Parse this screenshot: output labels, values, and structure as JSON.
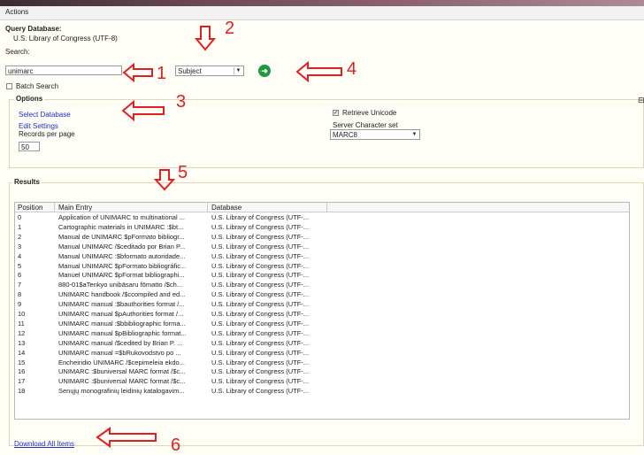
{
  "menu": {
    "actions": "Actions"
  },
  "query": {
    "label": "Query Database:",
    "database": "U.S. Library of Congress (UTF-8)",
    "search_label": "Search:",
    "search_value": "unimarc",
    "field_selected": "Subject",
    "batch_label": "Batch Search"
  },
  "options": {
    "legend": "Options",
    "select_database": "Select Database",
    "edit_settings": "Edit Settings",
    "records_label": "Records per page",
    "records_value": "50",
    "retrieve_unicode": "Retrieve Unicode",
    "charset_label": "Server Character set",
    "charset_value": "MARC8"
  },
  "results": {
    "legend": "Results",
    "columns": [
      "Position",
      "Main Entry",
      "Database"
    ],
    "rows": [
      [
        "0",
        "Application of UNIMARC to multinational ...",
        "U.S. Library of Congress (UTF-..."
      ],
      [
        "1",
        "Cartographic materials in UNIMARC :$bt...",
        "U.S. Library of Congress (UTF-..."
      ],
      [
        "2",
        "Manual de UNIMARC $pFormato bibliogr...",
        "U.S. Library of Congress (UTF-..."
      ],
      [
        "3",
        "Manual UNIMARC /$ceditado por Brian P...",
        "U.S. Library of Congress (UTF-..."
      ],
      [
        "4",
        "Manual UNIMARC :$bformato autoridade...",
        "U.S. Library of Congress (UTF-..."
      ],
      [
        "5",
        "Manual UNIMARC $pFormato bibliográfic...",
        "U.S. Library of Congress (UTF-..."
      ],
      [
        "6",
        "Manuel UNIMARC $pFormat bibliographi...",
        "U.S. Library of Congress (UTF-..."
      ],
      [
        "7",
        "880-01$aTenkyo unibāsaru fōmatto /$ch...",
        "U.S. Library of Congress (UTF-..."
      ],
      [
        "8",
        "UNIMARC handbook /$ccompiled and ed...",
        "U.S. Library of Congress (UTF-..."
      ],
      [
        "9",
        "UNIMARC manual :$bauthorities format /...",
        "U.S. Library of Congress (UTF-..."
      ],
      [
        "10",
        "UNIMARC manual $pAuthorities format /...",
        "U.S. Library of Congress (UTF-..."
      ],
      [
        "11",
        "UNIMARC manual :$bbibliographic forma...",
        "U.S. Library of Congress (UTF-..."
      ],
      [
        "12",
        "UNIMARC manual $pBibliographic format...",
        "U.S. Library of Congress (UTF-..."
      ],
      [
        "13",
        "UNIMARC manual /$cedited by Brian P. ...",
        "U.S. Library of Congress (UTF-..."
      ],
      [
        "14",
        "UNIMARC manual =$bRukovodstvo po ...",
        "U.S. Library of Congress (UTF-..."
      ],
      [
        "15",
        "Encheiridio UNIMARC /$cepimeleia ekdo...",
        "U.S. Library of Congress (UTF-..."
      ],
      [
        "16",
        "UNIMARC :$buniversal MARC format /$c...",
        "U.S. Library of Congress (UTF-..."
      ],
      [
        "17",
        "UNIMARC :$buniversal MARC format /$c...",
        "U.S. Library of Congress (UTF-..."
      ],
      [
        "18",
        "Senųjų monografinių leidinių katalogavim...",
        "U.S. Library of Congress (UTF-..."
      ]
    ],
    "download_all": "Download All Items"
  },
  "annotations": [
    "1",
    "2",
    "3",
    "4",
    "5",
    "6"
  ],
  "icons": {
    "go": "arrow-right-icon",
    "dropdown": "chevron-down-icon"
  },
  "colors": {
    "annotation": "#e02020",
    "link": "#2030c8",
    "go_button": "#1f9a3a"
  }
}
